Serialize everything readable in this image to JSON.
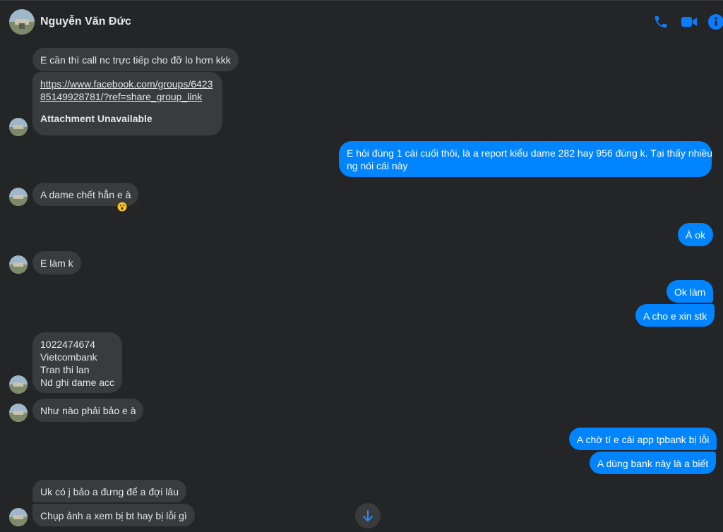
{
  "header": {
    "name": "Nguyễn Văn Đức",
    "accent": "#0084ff"
  },
  "icons": {
    "call": "phone-icon",
    "video": "video-camera-icon",
    "info": "info-icon",
    "scroll": "arrow-down-icon"
  },
  "messages": {
    "m1": "E cần thì call nc trực tiếp cho đỡ lo hơn kkk",
    "m2_link_line1": "https://www.facebook.com/groups/6423",
    "m2_link_line2": "85149928781/?ref=share_group_link",
    "m2_attachment": "Attachment Unavailable",
    "m3_line1": "E hỏi đúng 1 cái cuối thôi, là a report kiểu dame 282 hay 956 đúng k. Tại thấy nhiều",
    "m3_line2": "ng nói cái này",
    "m4": "A dame chết hẳn e à",
    "m5": "À ok",
    "m6": "E làm k",
    "m7": "Ok làm",
    "m8": "A cho e xin stk",
    "m9_line1": "1022474674",
    "m9_line2": "Vietcombank",
    "m9_line3": "Tran thi lan",
    "m9_line4": "Nd ghi dame acc",
    "m10": "Như nào phải bảo e à",
    "m11": "A chờ tí e cái app tpbank bị lỗi",
    "m12": "A dùng bank này là a biết",
    "m13": "Uk có j bảo a đưng để a đợi lâu",
    "m14": "Chụp ảnh a xem bị bt hay bị lỗi gì"
  },
  "reaction": "😮"
}
